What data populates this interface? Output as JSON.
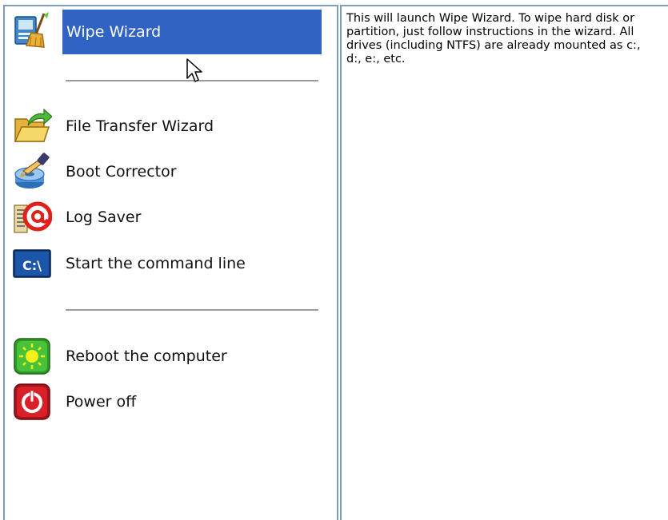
{
  "menu": {
    "items": [
      {
        "id": "wipe",
        "label": "Wipe Wizard",
        "icon": "wipe-broom-icon",
        "selected": true
      },
      {
        "id": "file-transfer",
        "label": "File Transfer Wizard",
        "icon": "folder-arrow-icon"
      },
      {
        "id": "boot",
        "label": "Boot Corrector",
        "icon": "disk-tool-icon"
      },
      {
        "id": "log",
        "label": "Log Saver",
        "icon": "mail-at-icon"
      },
      {
        "id": "cmd",
        "label": "Start the command line",
        "icon": "command-prompt-icon"
      },
      {
        "id": "reboot",
        "label": "Reboot the computer",
        "icon": "reboot-icon"
      },
      {
        "id": "poweroff",
        "label": "Power off",
        "icon": "power-off-icon"
      }
    ]
  },
  "icons": {
    "command_prompt_text": "C:\\"
  },
  "description": {
    "text": "This will launch Wipe Wizard. To wipe hard disk or partition, just follow instructions in the wizard. All drives (including NTFS) are already mounted as c:, d:, e:, etc."
  },
  "colors": {
    "selection": "#3163c5",
    "pane_border": "#7f9db9"
  }
}
